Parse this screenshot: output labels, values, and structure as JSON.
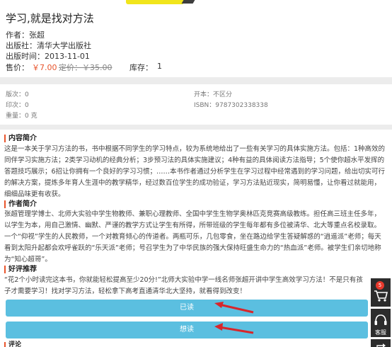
{
  "book": {
    "title": "学习,就是找对方法",
    "author_label": "作者：",
    "author": "张超",
    "publisher_label": "出版社：",
    "publisher": "清华大学出版社",
    "pubdate_label": "出版时间：",
    "pubdate": "2013-11-01",
    "price_label": "售价：",
    "price": "￥7.00",
    "list_price": "定价：￥35.00",
    "stock_label": "库存：",
    "stock": "1"
  },
  "specs": {
    "edition_label": "版次：",
    "edition": "0",
    "format_label": "开本：",
    "format": "不区分",
    "printing_label": "印次：",
    "printing": "0",
    "isbn_label": "ISBN：",
    "isbn": "9787302338338",
    "weight_label": "重量：",
    "weight": "0 克"
  },
  "sections": {
    "summary_title": "内容简介",
    "summary_text": "这是一本关于学习方法的书，书中根据不同学生的学习特点，较为系统地给出了一些有关学习的具体实施方法。包括：1种高效的同伴学习实施方法；2类学习动机的经典分析；3步预习法的具体实施建议；4种有益的具体阅读方法指导；5个使你超水平发挥的答题技巧展示；6招让你拥有一个良好的学习习惯；……本书作者通过分析学生在学习过程中经常遇到的学习问题，给出切实可行的解决方案，提炼多年育人生涯中的教学精华，经过数百位学生的成功验证，学习方法贴近现实，简明易懂，让你看过就能用，细细品味更有收获。",
    "author_title": "作者简介",
    "author_text": "张超管理学博士、北师大实验中学生物教师、兼职心理教师、全国中学生生物学奥林匹克竞赛高级教练。担任高三班主任多年，以学生为本，用自己激情、幽默、严谨的教学方式让学生有所得，所带班级的学生每年都有多位被清华、北大等重点名校录取。一个“仰视”学生的人民教师，一个对教育倾心的传道者。两瓶可乐，几包零食，坐在路边给学生答疑解惑的“逍遥派”老师；每天看到太阳升起都会欢呼雀跃的“乐天派”老师；号召学生为了中华民族的强大保持旺盛生命力的“热血派”老师。被学生们亲切地称为“知心超哥”。",
    "review_title": "好评推荐",
    "review_text": "“花2个小时读完这本书，你就能轻松提高至少20分!”北师大实验中学一线名师张超开讲中学生高效学习方法！不是只有孩子才需要学习！找对学习方法，轻松拿下高考直通清华北大坚持，就看得到改变！",
    "bottom_title": "评论"
  },
  "actions": {
    "read_label": "已读",
    "want_label": "想读"
  },
  "sidebar": {
    "cart_badge": "5",
    "service_label": "客服"
  },
  "colors": {
    "accent": "#e8542c",
    "button": "#5bbfe0",
    "arrow": "#d8262b"
  }
}
